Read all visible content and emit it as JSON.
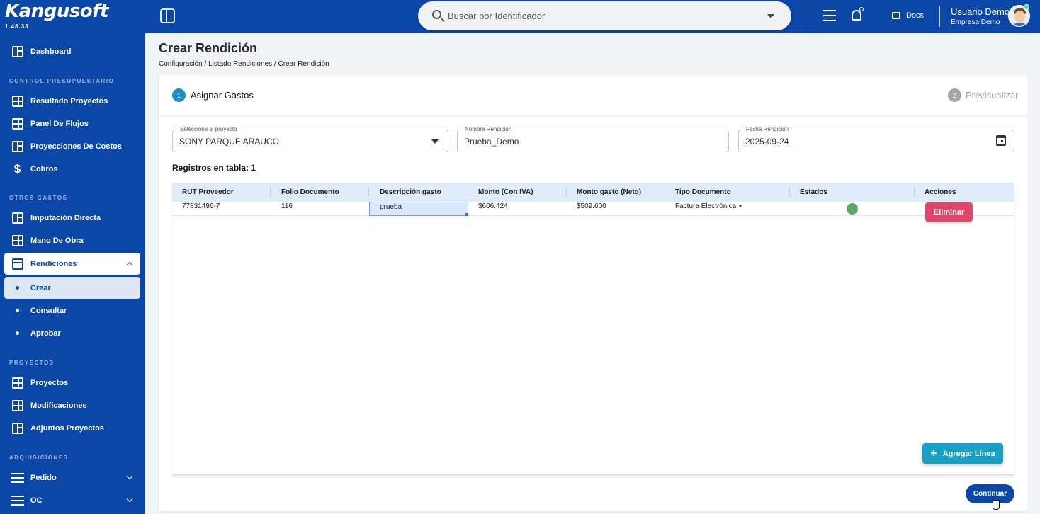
{
  "app": {
    "logo": "Kangusoft",
    "version": "1.48.33"
  },
  "topbar": {
    "search_placeholder": "Buscar por Identificador",
    "docs_label": "Docs",
    "user_name": "Usuario Demo",
    "user_company": "Empresa Demo"
  },
  "sidebar": {
    "dashboard": "Dashboard",
    "section_control": "CONTROL PRESUPUESTARIO",
    "resultado_proyectos": "Resultado Proyectos",
    "panel_flujos": "Panel De Flujos",
    "proyecciones_costos": "Proyecciones De Costos",
    "cobros": "Cobros",
    "section_otros": "OTROS GASTOS",
    "imputacion_directa": "Imputación Directa",
    "mano_obra": "Mano De Obra",
    "rendiciones": "Rendiciones",
    "crear": "Crear",
    "consultar": "Consultar",
    "aprobar": "Aprobar",
    "section_proyectos": "PROYECTOS",
    "proyectos": "Proyectos",
    "modificaciones": "Modificaciones",
    "adjuntos_proyectos": "Adjuntos Proyectos",
    "section_adquisiciones": "ADQUISICIONES",
    "pedido": "Pedido",
    "oc": "OC"
  },
  "page": {
    "title": "Crear Rendición",
    "breadcrumb": [
      "Configuración",
      "Listado Rendiciones",
      "Crear Rendición"
    ],
    "breadcrumb_sep": "/"
  },
  "stepper": {
    "step1_num": "1",
    "step1_label": "Asignar Gastos",
    "step2_num": "2",
    "step2_label": "Previsualizar"
  },
  "form": {
    "project_label": "Seleccione el proyecto",
    "project_value": "SONY PARQUE ARAUCO",
    "name_label": "Nombre Rendición",
    "name_value": "Prueba_Demo",
    "date_label": "Fecha Rendición",
    "date_value": "2025-09-24"
  },
  "table": {
    "count_text": "Registros en tabla: 1",
    "headers": [
      "RUT Proveedor",
      "Folio Documento",
      "Descripción gasto",
      "Monto (Con IVA)",
      "Monto gasto (Neto)",
      "Tipo Documento",
      "Estados",
      "Acciones"
    ],
    "rows": [
      {
        "rut": "77831496-7",
        "folio": "116",
        "descripcion": "prueba",
        "monto_iva": "$606.424",
        "monto_neto": "$509.600",
        "tipo": "Factura Electrónica",
        "estado_color": "#5aa861",
        "accion": "Eliminar"
      }
    ]
  },
  "buttons": {
    "add_line": "Agregar Línea",
    "continue": "Continuar"
  },
  "colors": {
    "brand": "#0b47a6",
    "accent": "#18a0c5",
    "danger": "#e0466a"
  }
}
